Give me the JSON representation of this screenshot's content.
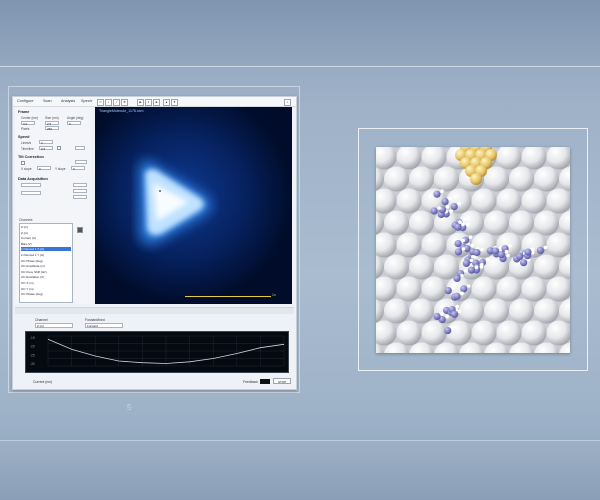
{
  "app": {
    "menu": [
      "Configure",
      "Scan",
      "Analysis",
      "Spectr"
    ],
    "left_panel": {
      "frame_title": "Frame",
      "frame_fields": [
        {
          "label": "Center (nm)",
          "value": "0.0"
        },
        {
          "label": "Size (nm)",
          "value": "2.5"
        },
        {
          "label": "Angle (deg)",
          "value": "0"
        },
        {
          "label": "Pixels",
          "value": "256"
        }
      ],
      "speed_title": "Speed",
      "speed_fields": [
        {
          "label": "Lines/s",
          "value": "2"
        },
        {
          "label": "Time/line",
          "value": "0.5"
        }
      ],
      "drift_title": "Tilt Correction",
      "drift_fields": [
        {
          "label": "X slope",
          "value": "0"
        },
        {
          "label": "Y slope",
          "value": "0"
        }
      ],
      "acq_title": "Data Acquisition",
      "channels_label": "Channels",
      "channels": [
        {
          "label": "Z (m)",
          "selected": false
        },
        {
          "label": "Z (m)",
          "selected": false
        },
        {
          "label": "Current (A)",
          "selected": false
        },
        {
          "label": "Bias (V)",
          "selected": false
        },
        {
          "label": "LI Demod 1 X (A)",
          "selected": true
        },
        {
          "label": "LI Demod 1 Y (A)",
          "selected": false
        },
        {
          "label": "OC Phase (deg)",
          "selected": false
        },
        {
          "label": "OC Amplitude (m)",
          "selected": false
        },
        {
          "label": "OC Freq. Shift (Hz)",
          "selected": false
        },
        {
          "label": "OC Excitation (V)",
          "selected": false
        },
        {
          "label": "OC X (m)",
          "selected": false
        },
        {
          "label": "OC Y (m)",
          "selected": false
        },
        {
          "label": "OC Phase (deg)",
          "selected": false
        }
      ]
    },
    "scan": {
      "title": "TriangleMolecule_1176.sxm",
      "scale_label": "1n"
    },
    "bottom": {
      "channel_label": "Channel",
      "channel_value": "Z (m)",
      "direction_label": "Forward/bwd",
      "direction_value": "Forward"
    },
    "status": {
      "current_label": "Current (nm)",
      "feedback_label": "Feedback",
      "stop_label": "STOP"
    }
  },
  "caption": "5",
  "colors": {
    "scan_background": "#000c2a",
    "scan_glow": "#2a7de0",
    "tip_gold": "#e8c66a",
    "molecule_blue": "#7f7fc4",
    "surface_atom": "#f0f0f2"
  },
  "chart_data": {
    "type": "line",
    "title": "",
    "xlabel": "",
    "ylabel": "",
    "x": [
      0,
      0.1,
      0.2,
      0.3,
      0.4,
      0.5,
      0.6,
      0.7,
      0.8,
      0.9,
      1.0
    ],
    "y_ticks": [
      "-15",
      "-20",
      "-25",
      "-30"
    ],
    "series": [
      {
        "values": [
          -14,
          -20,
          -24,
          -27,
          -28,
          -28.5,
          -27.5,
          -25.5,
          -22.5,
          -19,
          -17
        ]
      }
    ]
  }
}
